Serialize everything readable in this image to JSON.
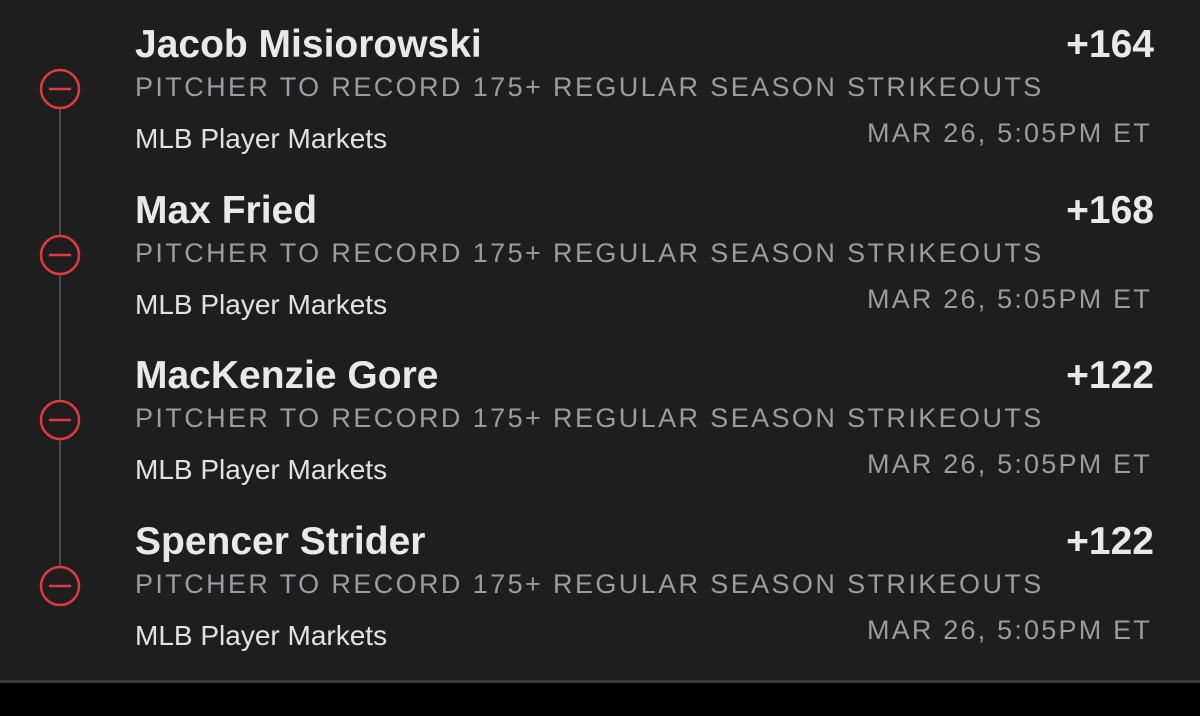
{
  "colors": {
    "background": "#1e1e1f",
    "primary_text": "#e9e9ea",
    "secondary_text": "#9c9c9e",
    "loss_icon": "#e0393e",
    "timeline": "#4a4a4c"
  },
  "legs": [
    {
      "player": "Jacob Misiorowski",
      "odds": "+164",
      "market": "PITCHER TO RECORD 175+ REGULAR SEASON STRIKEOUTS",
      "category": "MLB Player Markets",
      "datetime": "MAR 26, 5:05PM ET",
      "status_icon": "minus-circle-icon"
    },
    {
      "player": "Max Fried",
      "odds": "+168",
      "market": "PITCHER TO RECORD 175+ REGULAR SEASON STRIKEOUTS",
      "category": "MLB Player Markets",
      "datetime": "MAR 26, 5:05PM ET",
      "status_icon": "minus-circle-icon"
    },
    {
      "player": "MacKenzie Gore",
      "odds": "+122",
      "market": "PITCHER TO RECORD 175+ REGULAR SEASON STRIKEOUTS",
      "category": "MLB Player Markets",
      "datetime": "MAR 26, 5:05PM ET",
      "status_icon": "minus-circle-icon"
    },
    {
      "player": "Spencer Strider",
      "odds": "+122",
      "market": "PITCHER TO RECORD 175+ REGULAR SEASON STRIKEOUTS",
      "category": "MLB Player Markets",
      "datetime": "MAR 26, 5:05PM ET",
      "status_icon": "minus-circle-icon"
    }
  ]
}
